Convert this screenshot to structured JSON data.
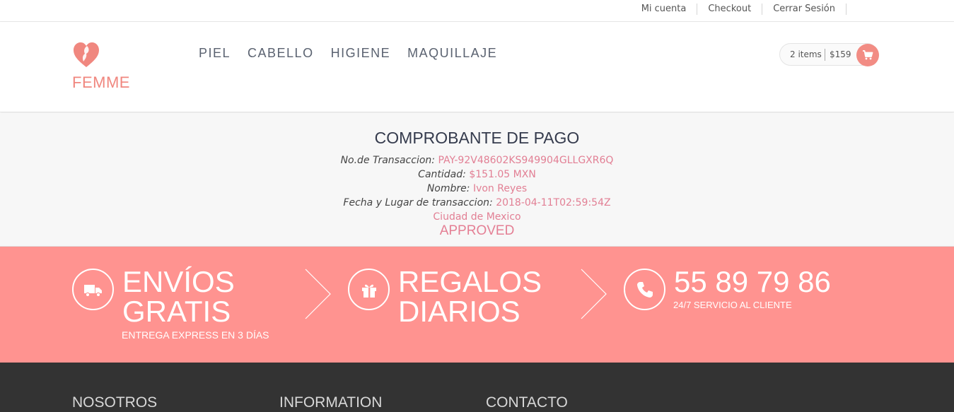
{
  "top_links": [
    "Mi cuenta",
    "Checkout",
    "Cerrar Sesión"
  ],
  "brand": {
    "name": "FEMME",
    "color": "#f0877f"
  },
  "nav": [
    "PIEL",
    "CABELLO",
    "HIGIENE",
    "MAQUILLAJE"
  ],
  "cart": {
    "items": "2 items",
    "total": "$159",
    "icon": "cart-icon"
  },
  "receipt": {
    "title": "COMPROBANTE DE PAGO",
    "transaction_label": "No.de Transaccion:",
    "transaction_value": "PAY-92V48602KS949904GLLGXR6Q",
    "amount_label": "Cantidad:",
    "amount_value": "$151.05 MXN",
    "name_label": "Nombre:",
    "name_value": "Ivon Reyes",
    "date_label": "Fecha y Lugar de transaccion:",
    "date_value": "2018-04-11T02:59:54Z",
    "place_value": "Ciudad de Mexico",
    "status": "APPROVED"
  },
  "features": [
    {
      "icon": "truck-icon",
      "title_1": "ENVÍOS",
      "title_2": "GRATIS",
      "subtitle": "ENTREGA EXPRESS EN 3 DÍAS"
    },
    {
      "icon": "gift-icon",
      "title_1": "REGALOS",
      "title_2": "DIARIOS",
      "subtitle": ""
    },
    {
      "icon": "phone-icon",
      "title_1": "55 89 79 86",
      "subtitle": "24/7 SERVICIO AL CLIENTE"
    }
  ],
  "footer": {
    "headings": [
      "NOSOTROS",
      "INFORMATION",
      "CONTACTO"
    ]
  },
  "colors": {
    "accent": "#ff9390",
    "link": "#e27f94",
    "footer_bg": "#333333"
  }
}
